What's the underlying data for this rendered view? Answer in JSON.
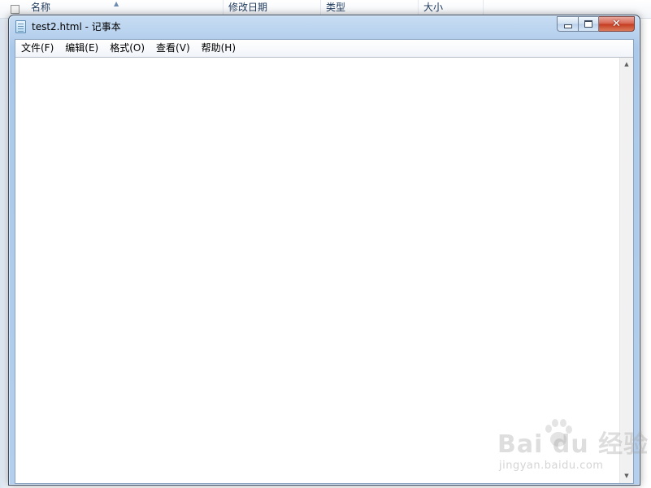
{
  "explorer": {
    "columns": [
      "名称",
      "修改日期",
      "类型",
      "大小"
    ]
  },
  "window": {
    "title": "test2.html - 记事本",
    "close_symbol": "✕"
  },
  "menu": [
    "文件(F)",
    "编辑(E)",
    "格式(O)",
    "查看(V)",
    "帮助(H)"
  ],
  "editor": {
    "content": ""
  },
  "watermark": {
    "brand": "Bai du 经验",
    "url": "jingyan.baidu.com"
  },
  "colors": {
    "title_bar": "#b9d2ee",
    "close_button": "#c4391f",
    "editor_background": "#ffffff"
  }
}
